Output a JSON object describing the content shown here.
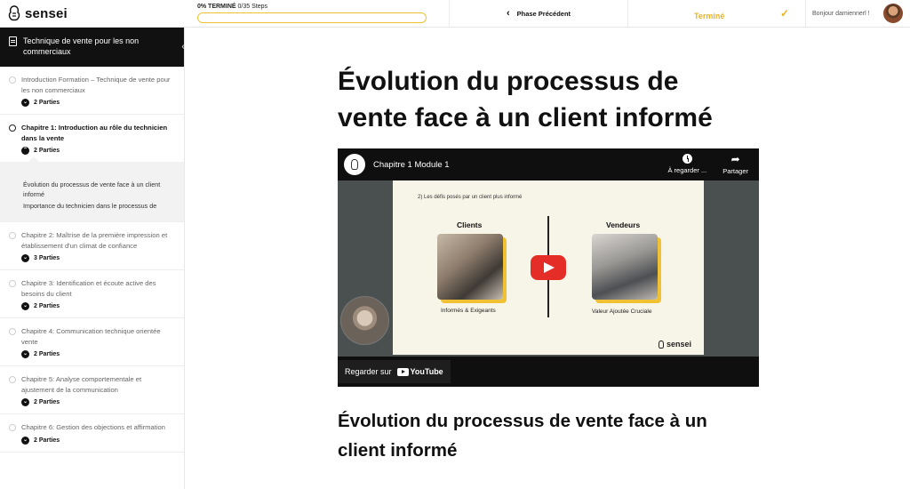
{
  "brand": {
    "name": "sensei"
  },
  "progress": {
    "percent_label": "0% TERMINÉ",
    "steps": "0/35 Steps",
    "value": 0
  },
  "nav": {
    "prev_label": "Phase Précédent",
    "done_label": "Terminé"
  },
  "user": {
    "greeting": "Bonjour damiennerl !"
  },
  "sidebar": {
    "course_title": "Technique de vente pour les non commerciaux",
    "lessons": [
      {
        "title": "Introduction Formation – Technique de vente pour les non commerciaux",
        "parts": "2 Parties"
      },
      {
        "title": "Chapitre 1: Introduction au rôle du technicien dans la vente",
        "parts": "2 Parties"
      },
      {
        "title": "Chapitre 2: Maîtrise de la première impression et établissement d'un climat de confiance",
        "parts": "3 Parties"
      },
      {
        "title": "Chapitre 3: Identification et écoute active des besoins du client",
        "parts": "2 Parties"
      },
      {
        "title": "Chapitre 4: Communication technique orientée vente",
        "parts": "2 Parties"
      },
      {
        "title": "Chapitre 5: Analyse comportementale et ajustement de la communication",
        "parts": "2 Parties"
      },
      {
        "title": "Chapitre 6: Gestion des objections et affirmation",
        "parts": "2 Parties"
      }
    ],
    "sub_items": [
      "Évolution du processus de vente face à un client informé",
      "Importance du technicien dans le processus de"
    ]
  },
  "main": {
    "title": "Évolution du processus de vente face à un client informé",
    "subtitle": "Évolution du processus de vente face à un client informé"
  },
  "video": {
    "title": "Chapitre 1 Module 1",
    "watch_later": "À regarder ...",
    "share": "Partager",
    "watch_on": "Regarder sur",
    "yt_word": "YouTube",
    "slide": {
      "question": "2) Les défis posés par un client plus informé",
      "left_head": "Clients",
      "left_caption": "Informés & Exigeants",
      "right_head": "Vendeurs",
      "right_caption": "Valeur Ajoutée Cruciale",
      "logo": "sensei"
    }
  }
}
